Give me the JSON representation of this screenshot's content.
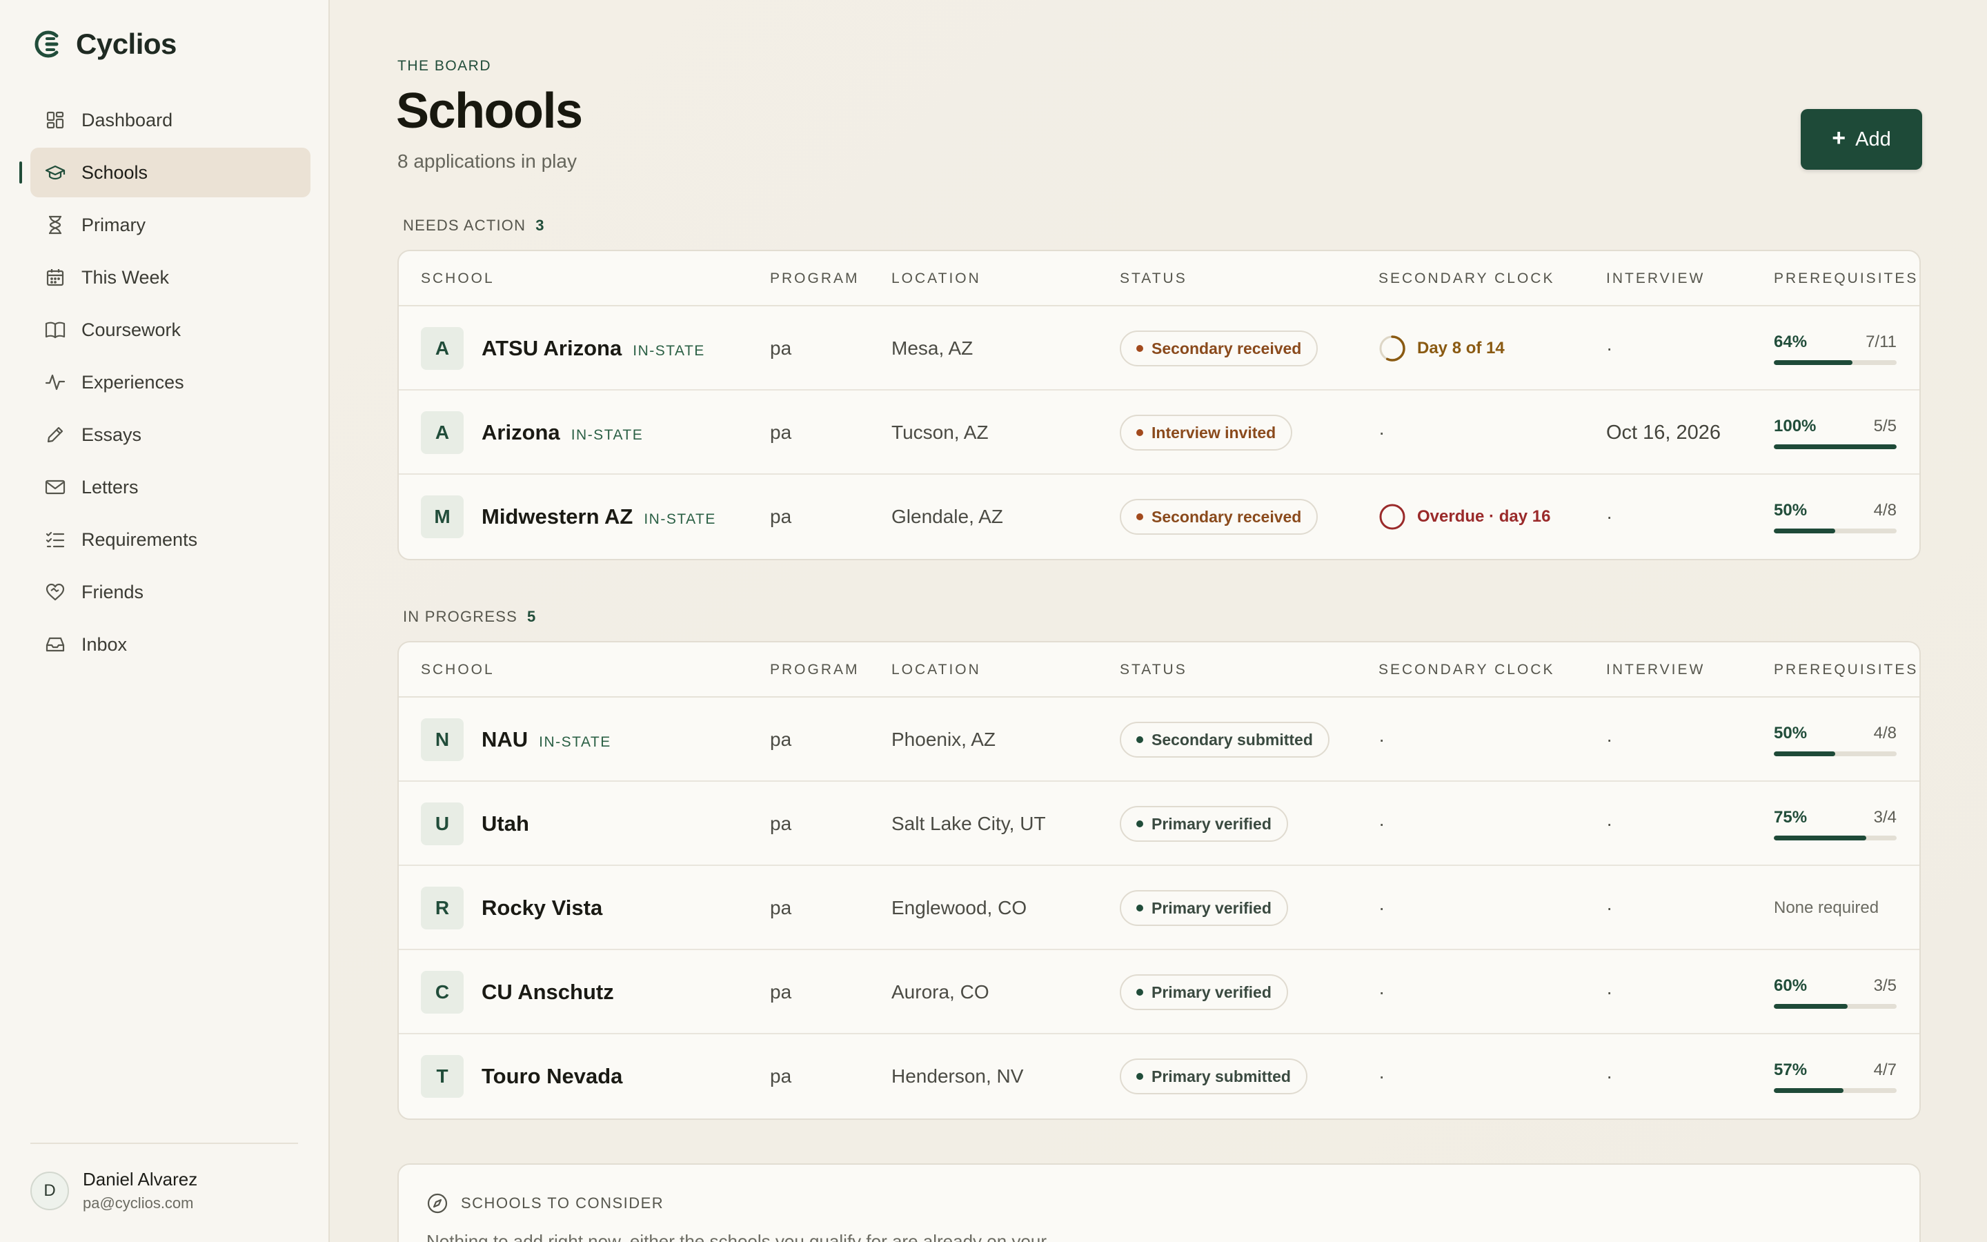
{
  "app": {
    "name": "Cyclios"
  },
  "sidebar": {
    "items": [
      {
        "label": "Dashboard",
        "icon": "dashboard-icon",
        "active": false
      },
      {
        "label": "Schools",
        "icon": "graduation-cap-icon",
        "active": true
      },
      {
        "label": "Primary",
        "icon": "hourglass-icon",
        "active": false
      },
      {
        "label": "This Week",
        "icon": "calendar-icon",
        "active": false
      },
      {
        "label": "Coursework",
        "icon": "book-icon",
        "active": false
      },
      {
        "label": "Experiences",
        "icon": "activity-icon",
        "active": false
      },
      {
        "label": "Essays",
        "icon": "pen-icon",
        "active": false
      },
      {
        "label": "Letters",
        "icon": "mail-icon",
        "active": false
      },
      {
        "label": "Requirements",
        "icon": "checklist-icon",
        "active": false
      },
      {
        "label": "Friends",
        "icon": "heart-handshake-icon",
        "active": false
      },
      {
        "label": "Inbox",
        "icon": "inbox-icon",
        "active": false
      }
    ],
    "user": {
      "initial": "D",
      "name": "Daniel Alvarez",
      "email": "pa@cyclios.com"
    }
  },
  "header": {
    "eyebrow": "THE BOARD",
    "title": "Schools",
    "subtitle": "8 applications in play",
    "add_label": "Add"
  },
  "columns": [
    "SCHOOL",
    "PROGRAM",
    "LOCATION",
    "STATUS",
    "SECONDARY CLOCK",
    "INTERVIEW",
    "PREREQUISITES"
  ],
  "sections": {
    "needs_action": {
      "label": "NEEDS ACTION",
      "count": "3",
      "rows": [
        {
          "letter": "A",
          "name": "ATSU Arizona",
          "tag": "IN-STATE",
          "program": "pa",
          "location": "Mesa, AZ",
          "status": "Secondary received",
          "status_tone": "warm",
          "clock": "Day 8 of 14",
          "clock_tone": "amber",
          "clock_fraction": 0.57,
          "interview": "·",
          "prereq_pct": "64%",
          "prereq_frac": "7/11",
          "prereq_value": 64
        },
        {
          "letter": "A",
          "name": "Arizona",
          "tag": "IN-STATE",
          "program": "pa",
          "location": "Tucson, AZ",
          "status": "Interview invited",
          "status_tone": "warm",
          "clock": "",
          "clock_tone": "",
          "clock_fraction": null,
          "interview": "Oct 16, 2026",
          "prereq_pct": "100%",
          "prereq_frac": "5/5",
          "prereq_value": 100
        },
        {
          "letter": "M",
          "name": "Midwestern AZ",
          "tag": "IN-STATE",
          "program": "pa",
          "location": "Glendale, AZ",
          "status": "Secondary received",
          "status_tone": "warm",
          "clock": "Overdue · day 16",
          "clock_tone": "red",
          "clock_fraction": 1,
          "interview": "·",
          "prereq_pct": "50%",
          "prereq_frac": "4/8",
          "prereq_value": 50
        }
      ]
    },
    "in_progress": {
      "label": "IN PROGRESS",
      "count": "5",
      "rows": [
        {
          "letter": "N",
          "name": "NAU",
          "tag": "IN-STATE",
          "program": "pa",
          "location": "Phoenix, AZ",
          "status": "Secondary submitted",
          "status_tone": "green",
          "clock": "",
          "interview": "·",
          "prereq_pct": "50%",
          "prereq_frac": "4/8",
          "prereq_value": 50
        },
        {
          "letter": "U",
          "name": "Utah",
          "tag": "",
          "program": "pa",
          "location": "Salt Lake City, UT",
          "status": "Primary verified",
          "status_tone": "green",
          "clock": "",
          "interview": "·",
          "prereq_pct": "75%",
          "prereq_frac": "3/4",
          "prereq_value": 75
        },
        {
          "letter": "R",
          "name": "Rocky Vista",
          "tag": "",
          "program": "pa",
          "location": "Englewood, CO",
          "status": "Primary verified",
          "status_tone": "green",
          "clock": "",
          "interview": "·",
          "prereq_none": "None required"
        },
        {
          "letter": "C",
          "name": "CU Anschutz",
          "tag": "",
          "program": "pa",
          "location": "Aurora, CO",
          "status": "Primary verified",
          "status_tone": "green",
          "clock": "",
          "interview": "·",
          "prereq_pct": "60%",
          "prereq_frac": "3/5",
          "prereq_value": 60
        },
        {
          "letter": "T",
          "name": "Touro Nevada",
          "tag": "",
          "program": "pa",
          "location": "Henderson, NV",
          "status": "Primary submitted",
          "status_tone": "green",
          "clock": "",
          "interview": "·",
          "prereq_pct": "57%",
          "prereq_frac": "4/7",
          "prereq_value": 57
        }
      ]
    }
  },
  "consider": {
    "title": "SCHOOLS TO CONSIDER",
    "body": "Nothing to add right now, either the schools you qualify for are already on your"
  },
  "empty_dash": "·",
  "colors": {
    "accent": "#1e4a38",
    "warm": "#a24a1d",
    "amber": "#8a5a12",
    "red": "#9a2a2a",
    "background": "#f1ede4"
  }
}
